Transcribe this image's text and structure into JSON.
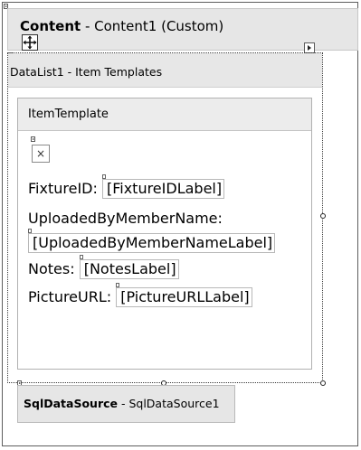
{
  "content_control": {
    "title_bold": "Content",
    "title_rest": " - Content1 (Custom)"
  },
  "datalist": {
    "title": "DataList1 - Item Templates",
    "template_name": "ItemTemplate"
  },
  "fields": [
    {
      "label": "FixtureID:",
      "bound": "[FixtureIDLabel]"
    },
    {
      "label": "UploadedByMemberName:",
      "bound": "[UploadedByMemberNameLabel]"
    },
    {
      "label": "Notes:",
      "bound": "[NotesLabel]"
    },
    {
      "label": "PictureURL:",
      "bound": "[PictureURLLabel]"
    }
  ],
  "image_placeholder": "×",
  "sqldatasource": {
    "title_bold": "SqlDataSource",
    "title_rest": " - SqlDataSource1"
  },
  "icons": {
    "move": "move-arrows-icon",
    "smart_tag": "smart-tag-arrow-icon",
    "broken_image": "broken-image-icon"
  }
}
